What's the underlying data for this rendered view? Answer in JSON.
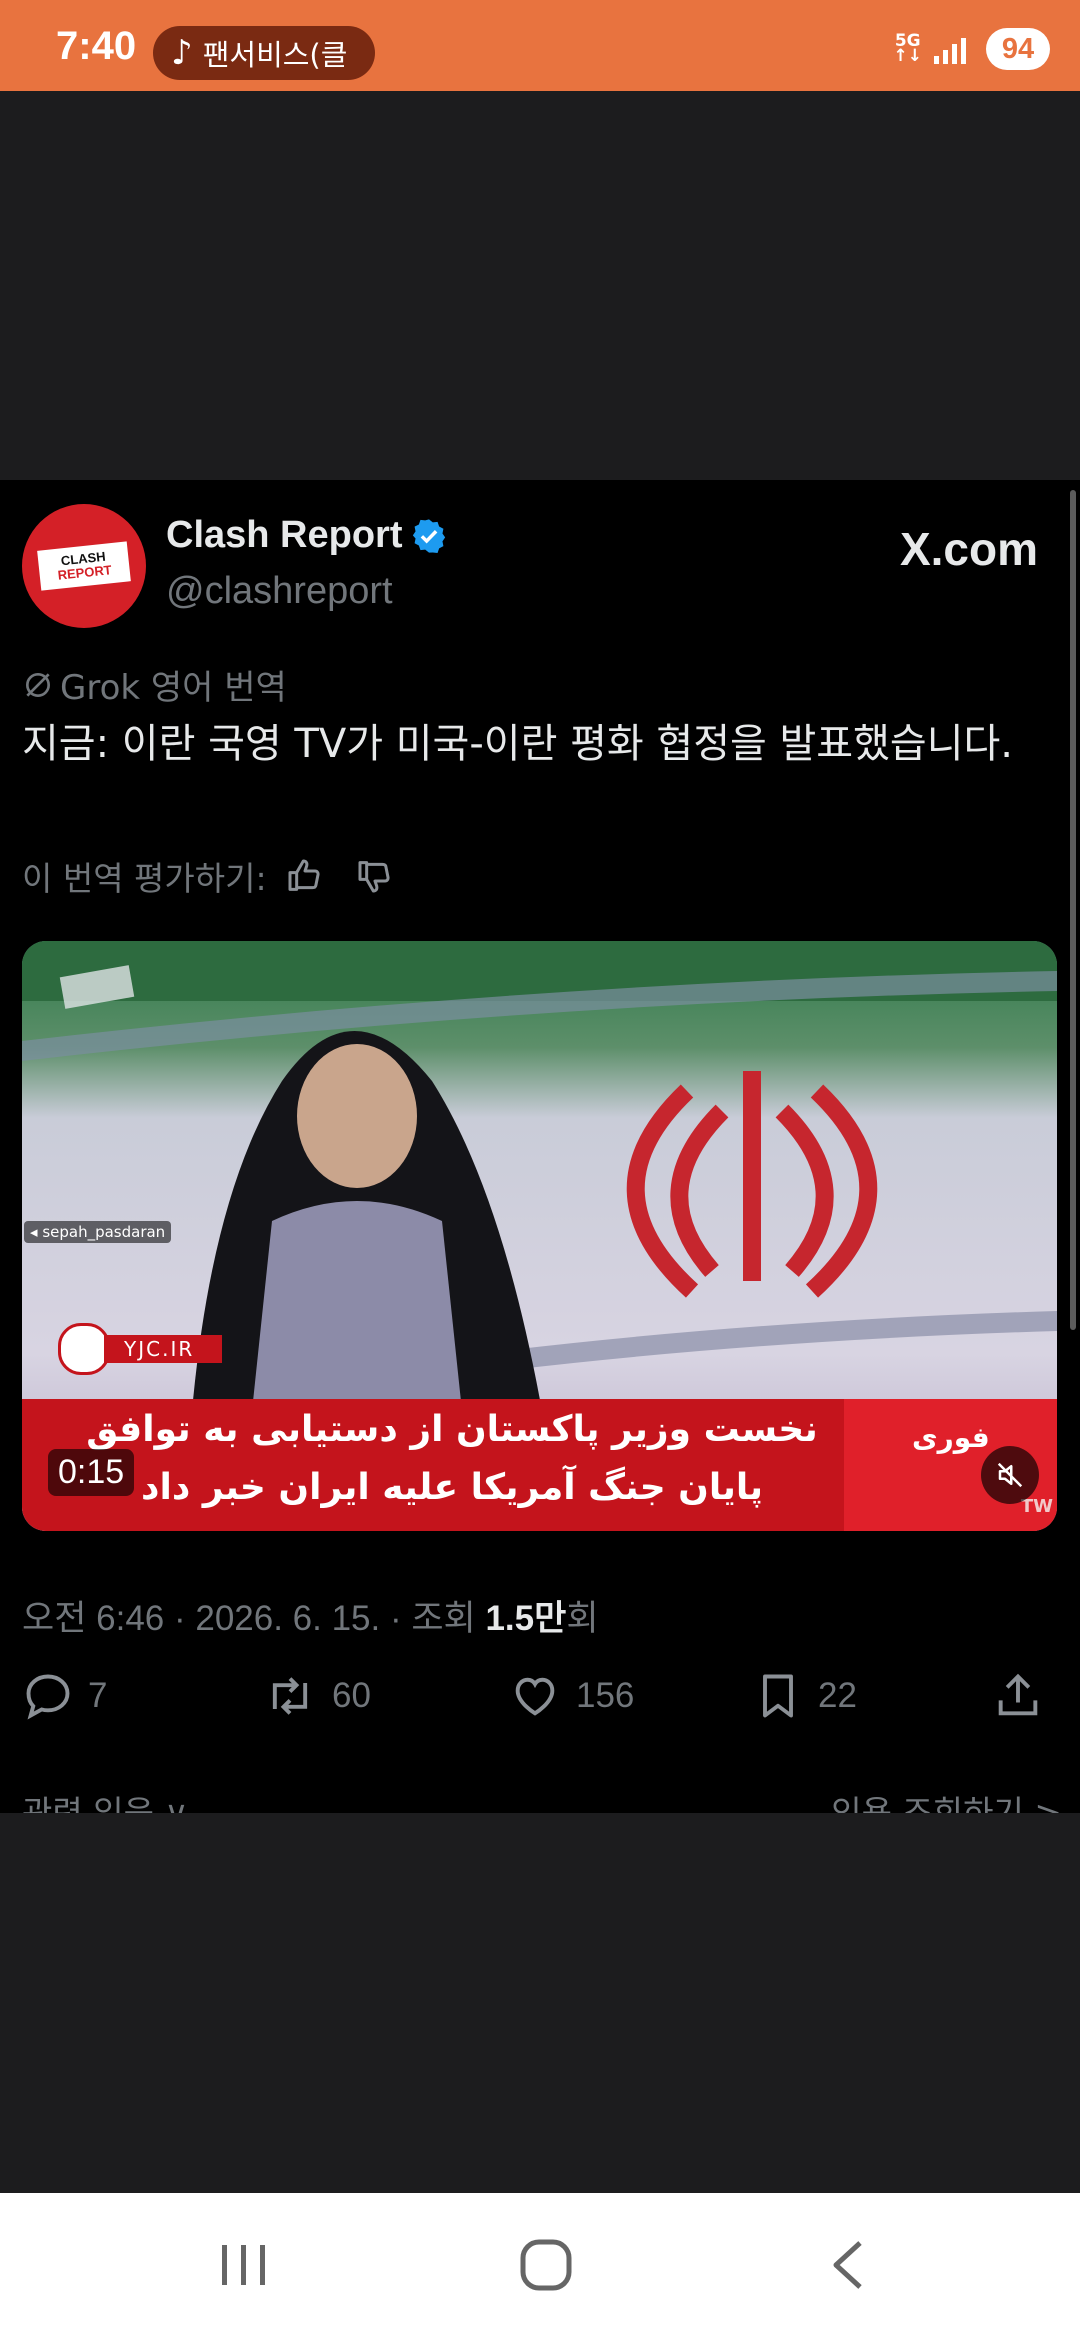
{
  "status_bar": {
    "time": "7:40",
    "notification_app": "팬서비스(클",
    "network": "5G",
    "battery": "94"
  },
  "tweet": {
    "author_name": "Clash Report",
    "author_handle": "@clashreport",
    "avatar_line1": "CLASH",
    "avatar_line2": "REPORT",
    "source_label": "X.com",
    "translation_label": "Grok 영어 번역",
    "text": "지금: 이란 국영 TV가 미국-이란 평화 협정을 발표했습니다.",
    "rate_translation_label": "이 번역 평가하기:",
    "video": {
      "duration": "0:15",
      "watermark_handle": "sepah_pasdaran",
      "channel_logo_text": "YJC.IR",
      "ticker_line1": "نخست وزیر پاکستان از دستیابی به توافق",
      "ticker_line2": "پایان جنگ آمریکا علیه ایران خبر داد",
      "ticker_badge": "فوری",
      "corner_mark": "TW"
    },
    "meta_time": "오전 6:46 · 2026. 6. 15. · 조회 ",
    "meta_views": "1.5만",
    "meta_suffix": "회",
    "replies": "7",
    "retweets": "60",
    "likes": "156",
    "bookmarks": "22",
    "related_left": "관련 있음 ∨",
    "related_right": "인용 조회하기 >"
  },
  "colors": {
    "status_bar": "#e8733f",
    "background": "#1c1c1e",
    "card": "#000000",
    "verified": "#1d9bf0",
    "muted_text": "#71767b"
  },
  "icons": [
    "music-note-icon",
    "signal-icon",
    "verified-badge-icon",
    "grok-icon",
    "thumbs-up-icon",
    "thumbs-down-icon",
    "mute-icon",
    "reply-icon",
    "retweet-icon",
    "like-icon",
    "bookmark-icon",
    "share-icon",
    "recents-icon",
    "home-icon",
    "back-icon"
  ]
}
